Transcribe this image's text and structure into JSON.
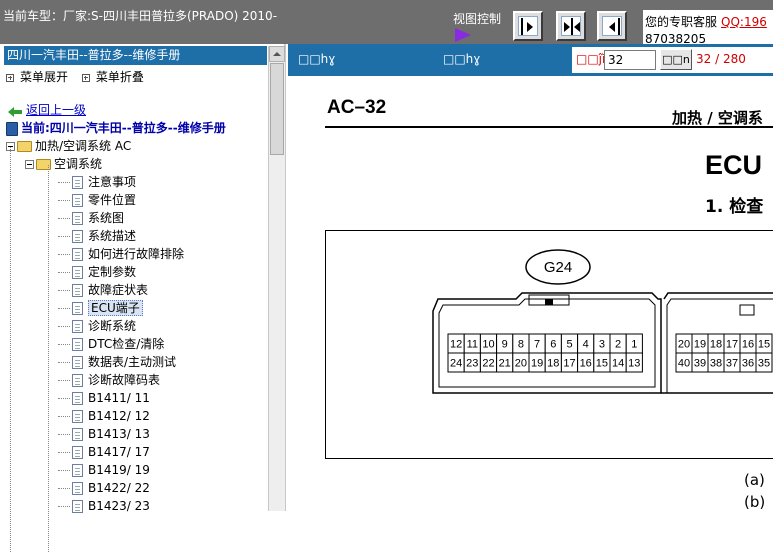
{
  "topbar": {
    "car_model": "当前车型：厂家:S-四川丰田普拉多(PRADO) 2010-",
    "view_control_label": "视图控制",
    "support_text": "您的专职客服",
    "support_qq": "QQ:196",
    "support_number": "87038205"
  },
  "left_panel": {
    "title": "四川一汽丰田--普拉多--维修手册",
    "expand_all": "菜单展开",
    "collapse_all": "菜单折叠",
    "back_link": "返回上一级",
    "current": "当前:四川一汽丰田--普拉多--维修手册",
    "tree": {
      "folder_1": "加热/空调系统 AC",
      "folder_2": "空调系统",
      "items": [
        {
          "label": "注意事项"
        },
        {
          "label": "零件位置"
        },
        {
          "label": "系统图"
        },
        {
          "label": "系统描述"
        },
        {
          "label": "如何进行故障排除"
        },
        {
          "label": "定制参数"
        },
        {
          "label": "故障症状表"
        },
        {
          "label": "ECU端子",
          "selected": true
        },
        {
          "label": "诊断系统"
        },
        {
          "label": "DTC检查/清除"
        },
        {
          "label": "数据表/主动测试"
        },
        {
          "label": "诊断故障码表"
        },
        {
          "label": "B1411/ 11"
        },
        {
          "label": "B1412/ 12"
        },
        {
          "label": "B1413/ 13"
        },
        {
          "label": "B1417/ 17"
        },
        {
          "label": "B1419/ 19"
        },
        {
          "label": "B1422/ 22"
        },
        {
          "label": "B1423/ 23"
        }
      ]
    }
  },
  "right_panel": {
    "prev_label": "□□hɣ",
    "next_label": "□□hɣ",
    "page_label": "□□ĵĭ",
    "page_input_value": "32",
    "go_button": "□□n",
    "page_count": "32 / 280"
  },
  "document": {
    "code": "AC–32",
    "section": "加热 / 空调系",
    "heading": "ECU",
    "step": "1.   检查",
    "connector_label": "G24",
    "row1_pins_left": [
      "12",
      "11",
      "10",
      "9",
      "8",
      "7",
      "6",
      "5",
      "4",
      "3",
      "2",
      "1"
    ],
    "row2_pins_left": [
      "24",
      "23",
      "22",
      "21",
      "20",
      "19",
      "18",
      "17",
      "16",
      "15",
      "14",
      "13"
    ],
    "row1_pins_right": [
      "20",
      "19",
      "18",
      "17",
      "16",
      "15"
    ],
    "row2_pins_right": [
      "40",
      "39",
      "38",
      "37",
      "36",
      "35"
    ],
    "note_a": "(a)",
    "note_b": "(b)"
  },
  "colors": {
    "topbar_bg": "#6e6e6e",
    "panel_header_bg": "#1e6ea8",
    "accent_red": "#d00000",
    "arrow_purple": "#8a2be2"
  },
  "icons": [
    "view-right-icon",
    "view-split-icon",
    "view-left-icon",
    "back-arrow-icon",
    "book-icon",
    "folder-icon",
    "document-icon",
    "expand-icon",
    "collapse-icon"
  ]
}
